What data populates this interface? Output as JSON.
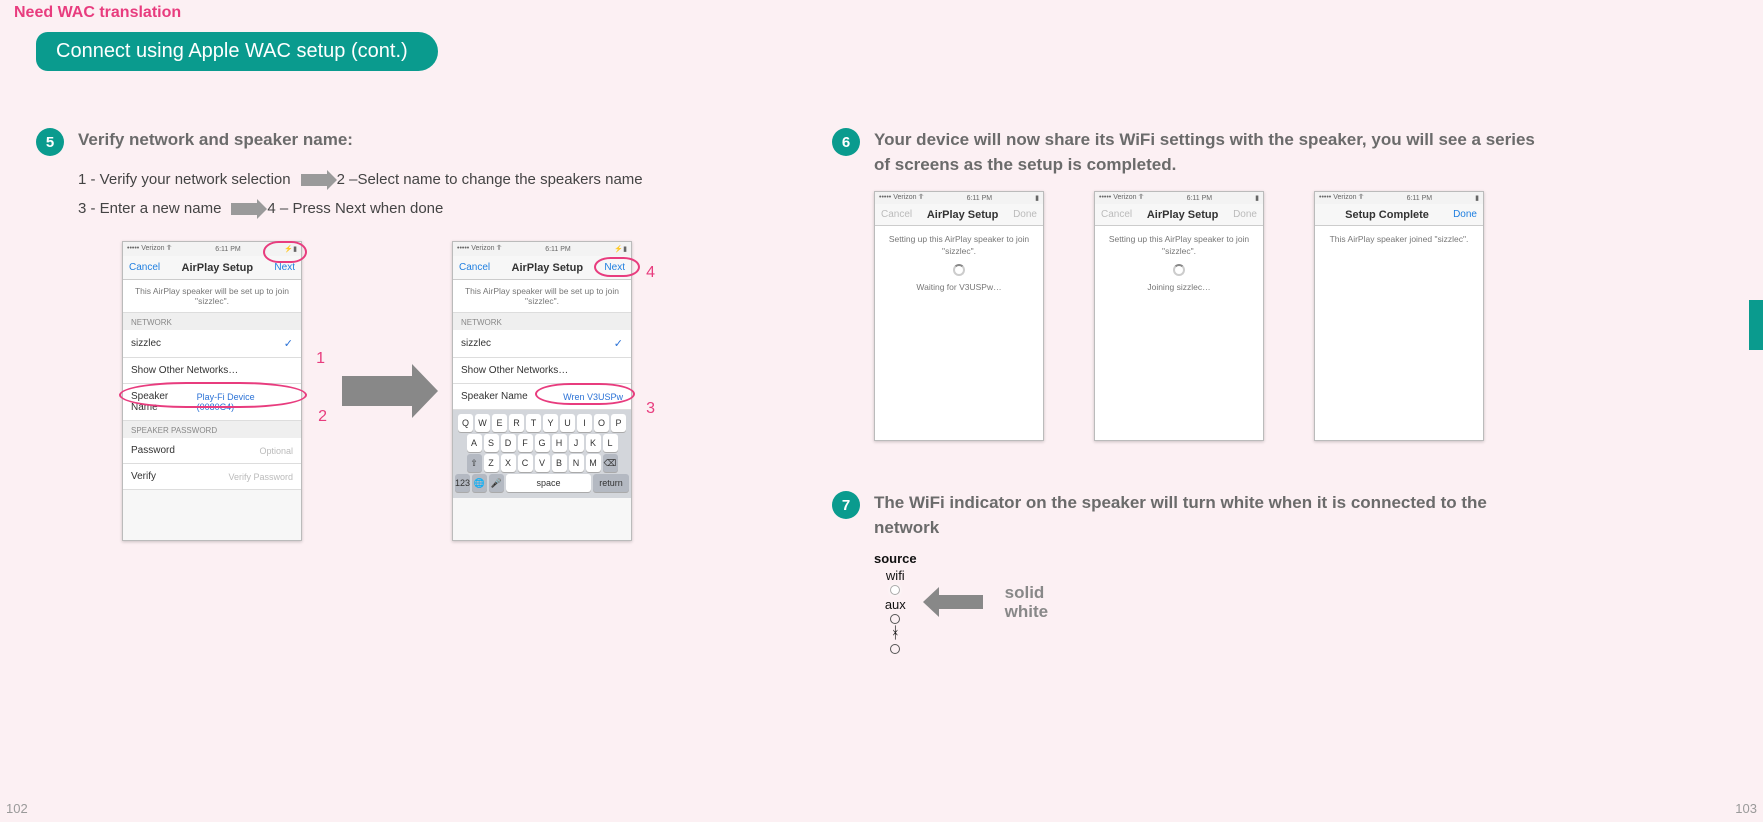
{
  "note": "Need WAC translation",
  "header": "Connect using Apple WAC setup (cont.)",
  "page_left": "102",
  "page_right": "103",
  "step5": {
    "num": "5",
    "title": "Verify network and speaker name:",
    "sub1a": "1 - Verify your network selection",
    "sub1b": "2 –Select name to change the speakers name",
    "sub2a": "3 - Enter a new name",
    "sub2b": "4 – Press Next when done",
    "labels": {
      "l1": "1",
      "l2": "2",
      "l3": "3",
      "l4": "4"
    }
  },
  "phoneA": {
    "carrier": "••••• Verizon ⥣",
    "time": "6:11 PM",
    "batt": "⚡▮",
    "nav_left": "Cancel",
    "nav_title": "AirPlay Setup",
    "nav_right": "Next",
    "msg": "This AirPlay speaker will be set up to join \"sizzlec\".",
    "h_network": "NETWORK",
    "row_net": "sizzlec",
    "row_other": "Show Other Networks…",
    "row_spk_label": "Speaker Name",
    "row_spk_val": "Play-Fi Device (0080C4)",
    "h_pw": "SPEAKER PASSWORD",
    "row_pw_label": "Password",
    "row_pw_ph": "Optional",
    "row_vf_label": "Verify",
    "row_vf_ph": "Verify Password"
  },
  "phoneB": {
    "carrier": "••••• Verizon ⥣",
    "time": "6:11 PM",
    "batt": "⚡▮",
    "nav_left": "Cancel",
    "nav_title": "AirPlay Setup",
    "nav_right": "Next",
    "msg": "This AirPlay speaker will be set up to join \"sizzlec\".",
    "h_network": "NETWORK",
    "row_net": "sizzlec",
    "row_other": "Show Other Networks…",
    "row_spk_label": "Speaker Name",
    "row_spk_val": "Wren V3USPw",
    "kb": {
      "r1": [
        "Q",
        "W",
        "E",
        "R",
        "T",
        "Y",
        "U",
        "I",
        "O",
        "P"
      ],
      "r2": [
        "A",
        "S",
        "D",
        "F",
        "G",
        "H",
        "J",
        "K",
        "L"
      ],
      "r3": [
        "⇧",
        "Z",
        "X",
        "C",
        "V",
        "B",
        "N",
        "M",
        "⌫"
      ],
      "r4_123": "123",
      "r4_globe": "🌐",
      "r4_mic": "🎤",
      "r4_space": "space",
      "r4_return": "return"
    }
  },
  "step6": {
    "num": "6",
    "title": "Your device will now share its WiFi settings with the speaker, you will see a series of screens as the setup is completed."
  },
  "mini1": {
    "carrier": "••••• Verizon ⥣",
    "time": "6:11 PM",
    "nav_left": "Cancel",
    "nav_title": "AirPlay Setup",
    "nav_right": "Done",
    "l1": "Setting up this AirPlay speaker to join \"sizzlec\".",
    "l2": "Waiting for V3USPw…"
  },
  "mini2": {
    "carrier": "••••• Verizon ⥣",
    "time": "6:11 PM",
    "nav_left": "Cancel",
    "nav_title": "AirPlay Setup",
    "nav_right": "Done",
    "l1": "Setting up this AirPlay speaker to join \"sizzlec\".",
    "l2": "Joining sizzlec…"
  },
  "mini3": {
    "carrier": "••••• Verizon ⥣",
    "time": "6:11 PM",
    "nav_left": "",
    "nav_title": "Setup Complete",
    "nav_right": "Done",
    "l1": "This AirPlay speaker joined \"sizzlec\"."
  },
  "step7": {
    "num": "7",
    "title": "The WiFi indicator on the speaker will turn white when it is connected to the network",
    "src_header": "source",
    "wifi": "wifi",
    "aux": "aux",
    "solid": "solid\nwhite"
  }
}
